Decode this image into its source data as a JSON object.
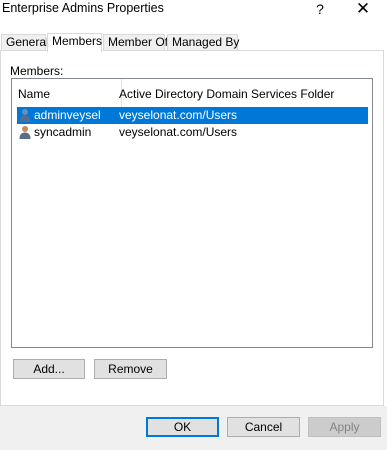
{
  "window": {
    "title": "Enterprise Admins Properties",
    "help_label": "?",
    "close_label": "✕"
  },
  "tabs": [
    {
      "label": "General",
      "active": false
    },
    {
      "label": "Members",
      "active": true
    },
    {
      "label": "Member Of",
      "active": false
    },
    {
      "label": "Managed By",
      "active": false
    }
  ],
  "members": {
    "label": "Members:",
    "columns": [
      "Name",
      "Active Directory Domain Services Folder"
    ],
    "rows": [
      {
        "name": "adminveysel",
        "folder": "veyselonat.com/Users",
        "selected": true,
        "icon": "user-icon"
      },
      {
        "name": "syncadmin",
        "folder": "veyselonat.com/Users",
        "selected": false,
        "icon": "user-icon"
      }
    ]
  },
  "actions": {
    "add_label": "Add...",
    "remove_label": "Remove"
  },
  "footer": {
    "ok_label": "OK",
    "cancel_label": "Cancel",
    "apply_label": "Apply"
  },
  "colors": {
    "selection": "#0078d7",
    "footer_bg": "#f0f0f0"
  }
}
